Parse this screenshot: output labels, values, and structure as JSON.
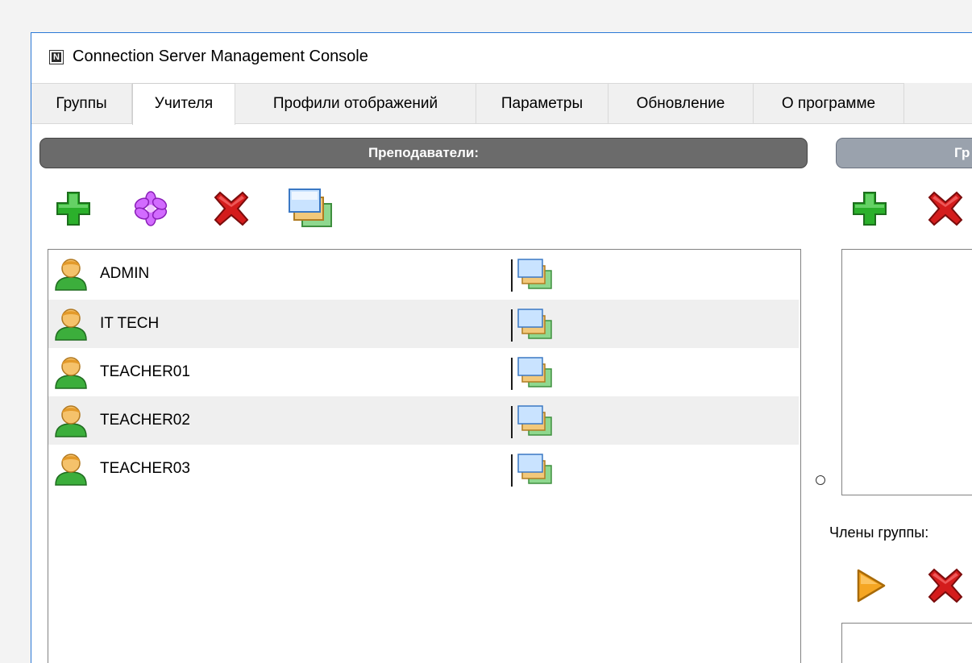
{
  "window": {
    "title": "Connection Server Management Console",
    "app_icon_letter": "N"
  },
  "tabs": [
    {
      "label": "Группы",
      "active": false
    },
    {
      "label": "Учителя",
      "active": true
    },
    {
      "label": "Профили отображений",
      "active": false
    },
    {
      "label": "Параметры",
      "active": false
    },
    {
      "label": "Обновление",
      "active": false
    },
    {
      "label": "О программе",
      "active": false
    }
  ],
  "teachers_panel": {
    "header": "Преподаватели:",
    "toolbar": [
      "add-icon",
      "edit-star-icon",
      "delete-icon",
      "display-profile-icon"
    ],
    "rows": [
      {
        "name": "ADMIN"
      },
      {
        "name": "IT TECH"
      },
      {
        "name": "TEACHER01"
      },
      {
        "name": "TEACHER02"
      },
      {
        "name": "TEACHER03"
      }
    ]
  },
  "groups_panel": {
    "header": "Гр",
    "toolbar": [
      "add-icon",
      "delete-icon"
    ],
    "members_label": "Члены группы:",
    "members_toolbar": [
      "play-icon",
      "delete-icon"
    ]
  },
  "colors": {
    "header_dark": "#6b6b6b",
    "header_light": "#9aa2ad",
    "alt_row": "#efefef",
    "window_border": "#2b79d6"
  }
}
